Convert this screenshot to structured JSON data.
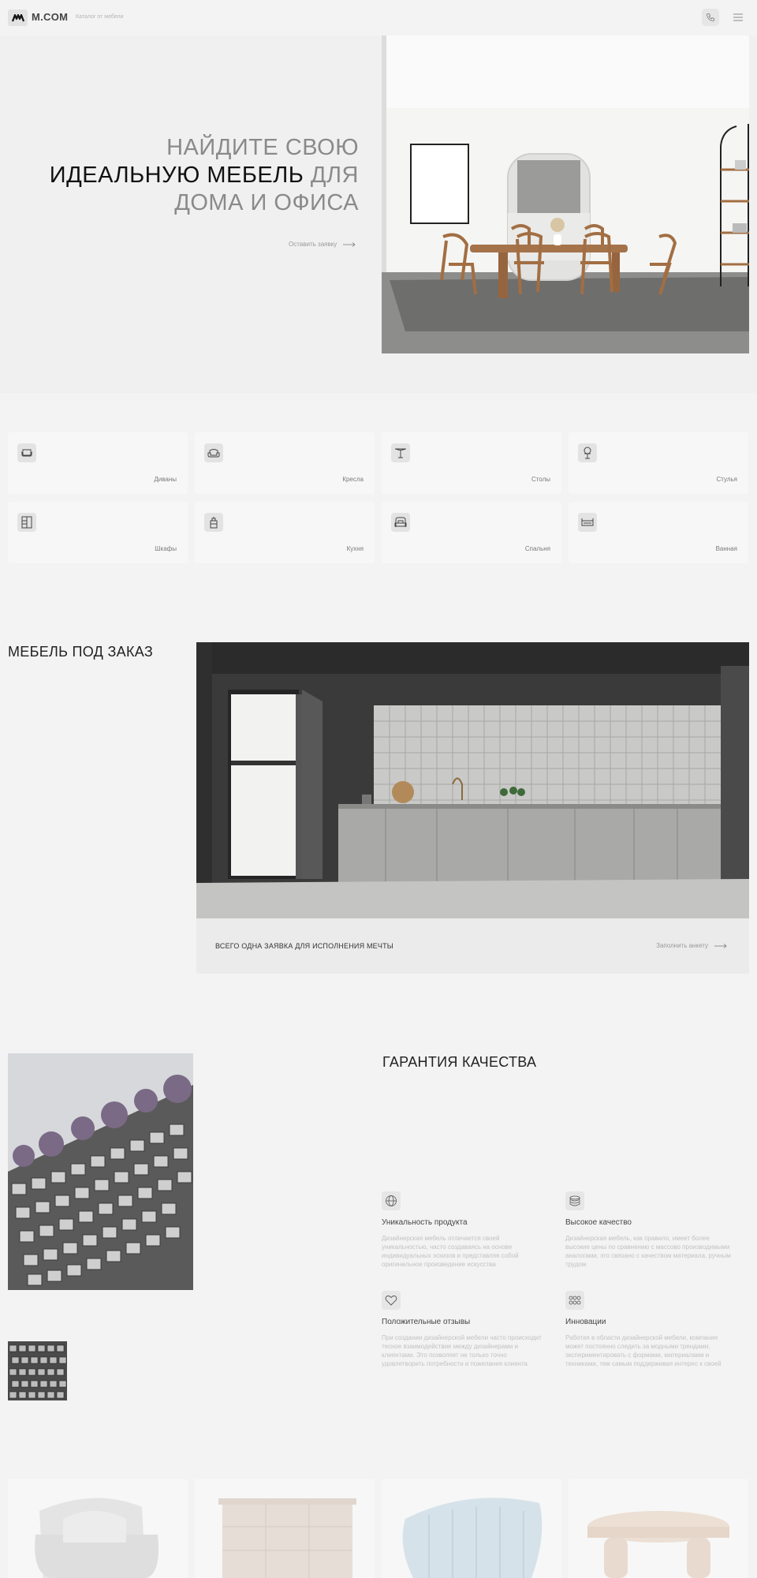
{
  "header": {
    "brand": "M.COM",
    "tagline": "Каталог от мебели"
  },
  "hero": {
    "title_line1": "НАЙДИТЕ СВОЮ",
    "title_line2_dark": "ИДЕАЛЬНУЮ МЕБЕЛЬ",
    "title_line2_light": "ДЛЯ",
    "title_line3": "ДОМА И ОФИСА",
    "cta_label": "Оставить заявку"
  },
  "categories": [
    {
      "label": "Диваны",
      "icon": "sofa-icon"
    },
    {
      "label": "Кресла",
      "icon": "armchair-icon"
    },
    {
      "label": "Столы",
      "icon": "table-icon"
    },
    {
      "label": "Стулья",
      "icon": "chair-icon"
    },
    {
      "label": "Шкафы",
      "icon": "wardrobe-icon"
    },
    {
      "label": "Кухня",
      "icon": "kitchen-icon"
    },
    {
      "label": "Спальня",
      "icon": "bedroom-icon"
    },
    {
      "label": "Ванная",
      "icon": "bath-icon"
    }
  ],
  "custom": {
    "title": "МЕБЕЛЬ ПОД ЗАКАЗ",
    "bar_text": "ВСЕГО ОДНА ЗАЯВКА ДЛЯ ИСПОЛНЕНИЯ МЕЧТЫ",
    "cta_label": "Заполнить анкету"
  },
  "quality": {
    "title": "ГАРАНТИЯ КАЧЕСТВА",
    "features": [
      {
        "title": "Уникальность продукта",
        "text": "Дизайнерская мебель отличается своей уникальностью, часто создаваясь на основе индивидуальных эскизов и представляя собой оригинальное произведение искусства",
        "icon": "globe-icon"
      },
      {
        "title": "Высокое качество",
        "text": "Дизайнерская мебель, как правило, имеет более высокие цены по сравнению с массово производимыми аналогами, это связано с качеством материала, ручным трудом",
        "icon": "layers-icon"
      },
      {
        "title": "Положительные отзывы",
        "text": "При создании дизайнерской мебели часто происходит тесное взаимодействие между дизайнерами и клиентами. Это позволяет не только точно удовлетворить потребности и пожелания клиента",
        "icon": "heart-icon"
      },
      {
        "title": "Инновации",
        "text": "Работая в области дизайнерской мебели, компания может постоянно следить за модными трендами, экспериментировать с формами, материалами и техниками, тем самым поддерживая интерес к своей",
        "icon": "grid-icon"
      }
    ]
  },
  "colors": {
    "background": "#f3f3f3",
    "card": "#f7f7f7",
    "text_dark": "#111111",
    "text_muted": "#8a8a8a"
  }
}
